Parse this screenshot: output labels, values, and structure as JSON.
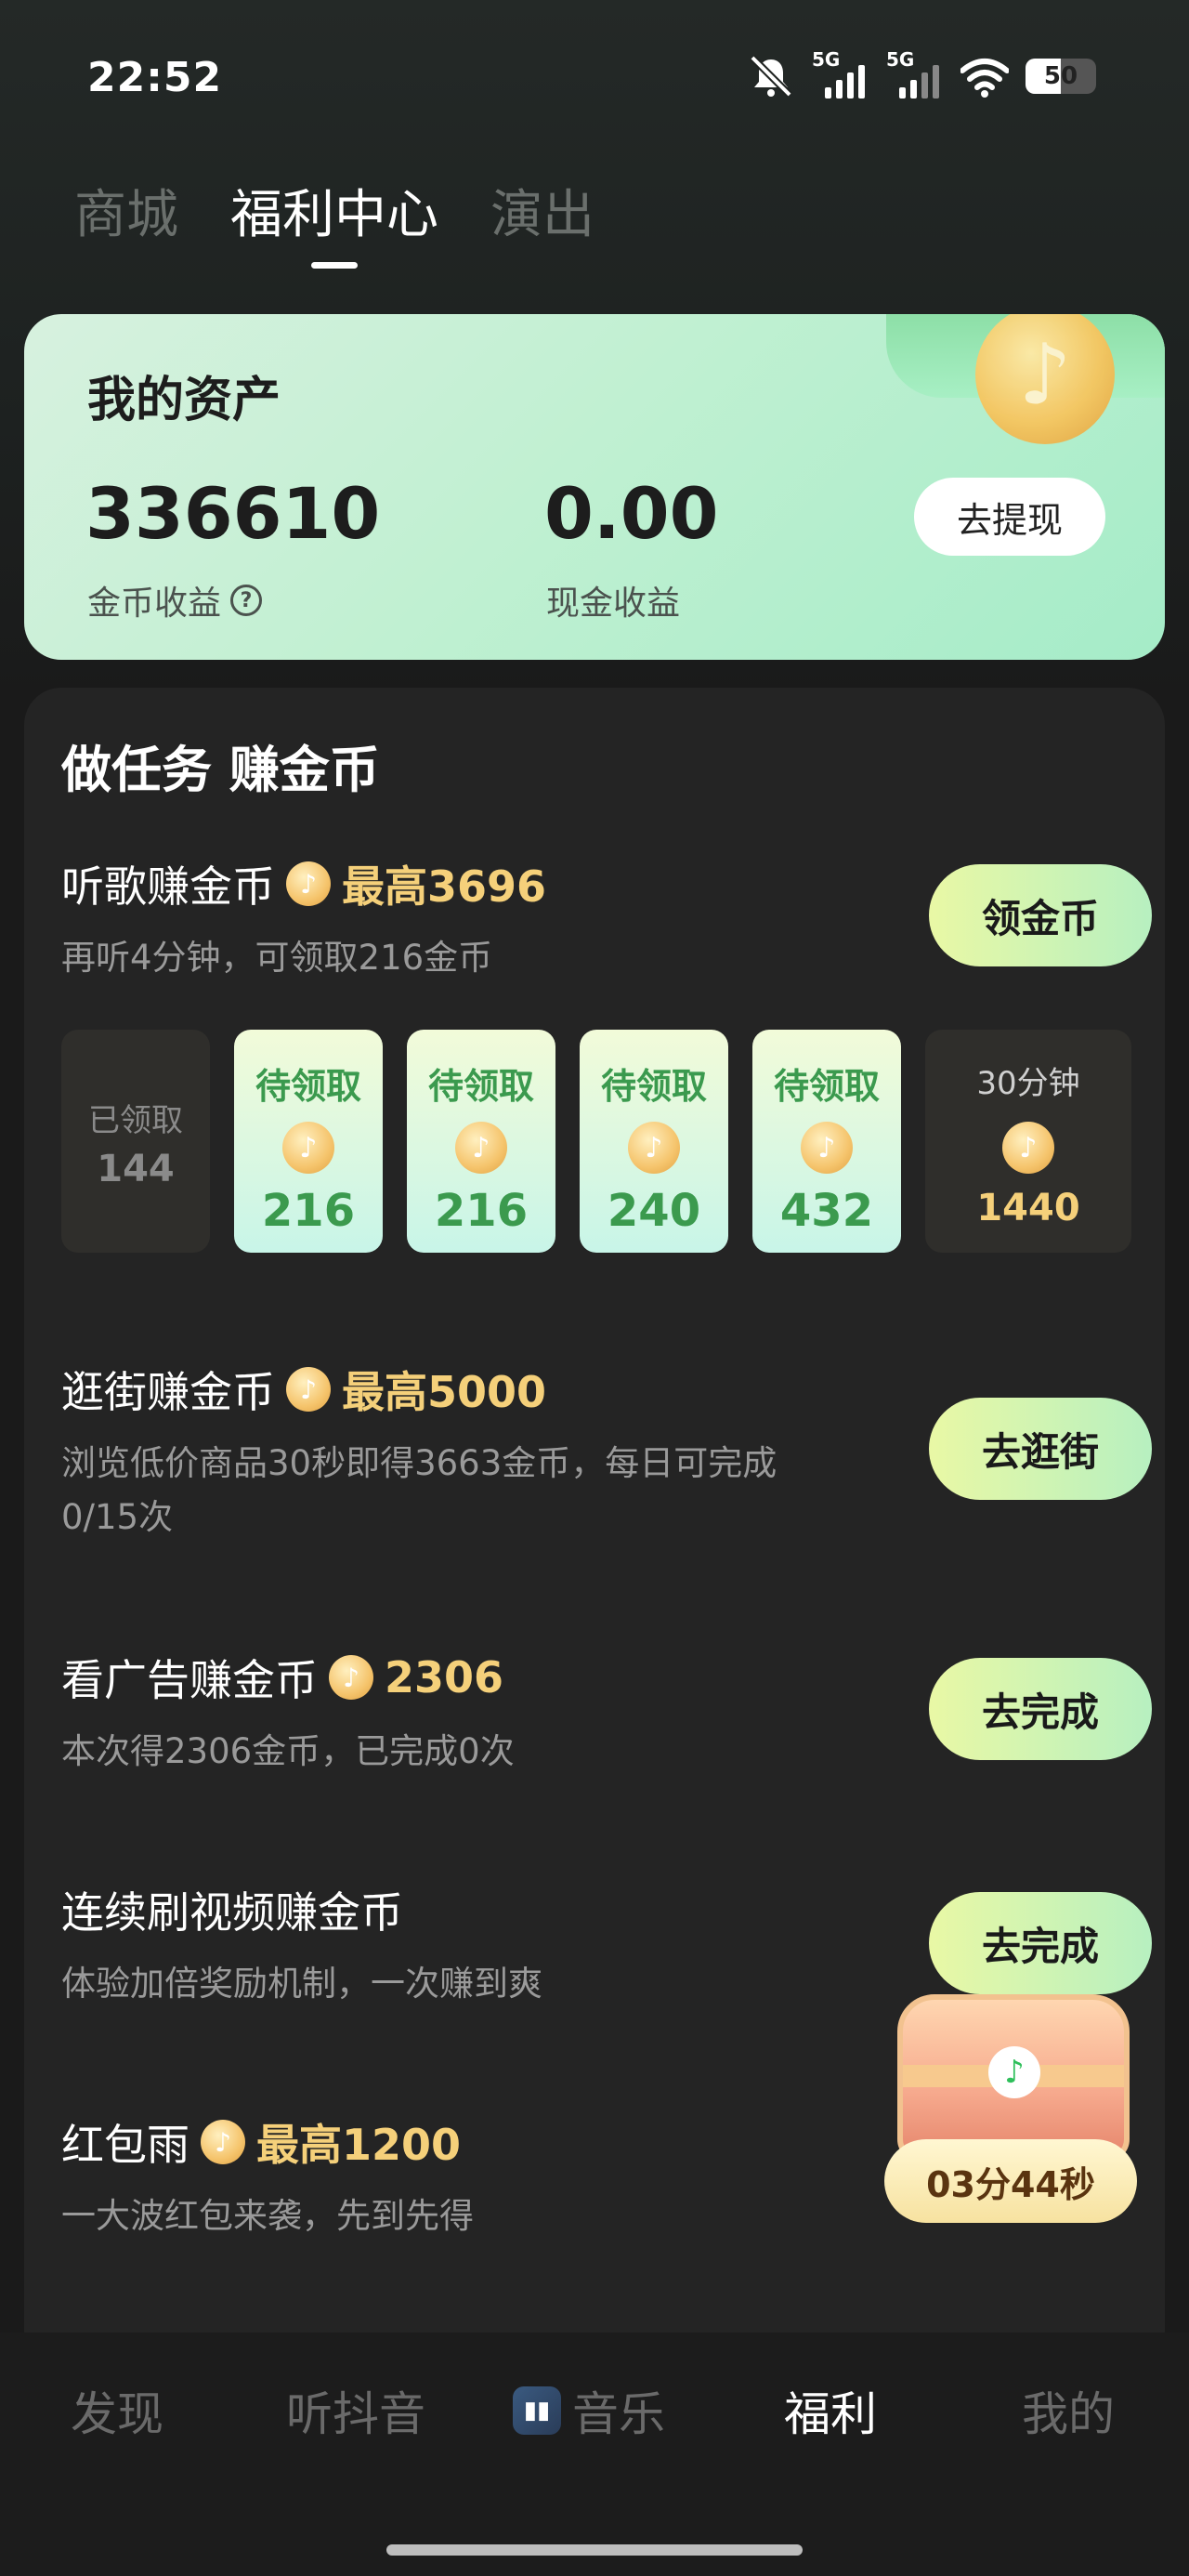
{
  "status": {
    "time": "22:52",
    "net1": "5G",
    "net2": "5G",
    "battery": "50"
  },
  "top_tabs": [
    "商城",
    "福利中心",
    "演出"
  ],
  "assets": {
    "title": "我的资产",
    "coins": "336610",
    "coins_label": "金币收益",
    "cash": "0.00",
    "cash_label": "现金收益",
    "withdraw": "去提现"
  },
  "tasks_heading": "做任务 赚金币",
  "listen": {
    "title": "听歌赚金币",
    "reward": "最高3696",
    "sub": "再听4分钟，可领取216金币",
    "button": "领金币",
    "progress": [
      {
        "label": "已领取",
        "value": "144"
      },
      {
        "label": "待领取",
        "value": "216"
      },
      {
        "label": "待领取",
        "value": "216"
      },
      {
        "label": "待领取",
        "value": "240"
      },
      {
        "label": "待领取",
        "value": "432"
      },
      {
        "label": "30分钟",
        "value": "1440"
      }
    ]
  },
  "shop": {
    "title": "逛街赚金币",
    "reward": "最高5000",
    "sub": "浏览低价商品30秒即得3663金币，每日可完成0/15次",
    "button": "去逛街"
  },
  "ads": {
    "title": "看广告赚金币",
    "reward": "2306",
    "sub": "本次得2306金币，已完成0次",
    "button": "去完成"
  },
  "video": {
    "title": "连续刷视频赚金币",
    "sub": "体验加倍奖励机制，一次赚到爽",
    "button": "去完成"
  },
  "redpack": {
    "title": "红包雨",
    "reward": "最高1200",
    "sub": "一大波红包来袭，先到先得"
  },
  "treasure": {
    "timer": "03分44秒"
  },
  "bottom_nav": [
    "发现",
    "听抖音",
    "音乐",
    "福利",
    "我的"
  ]
}
